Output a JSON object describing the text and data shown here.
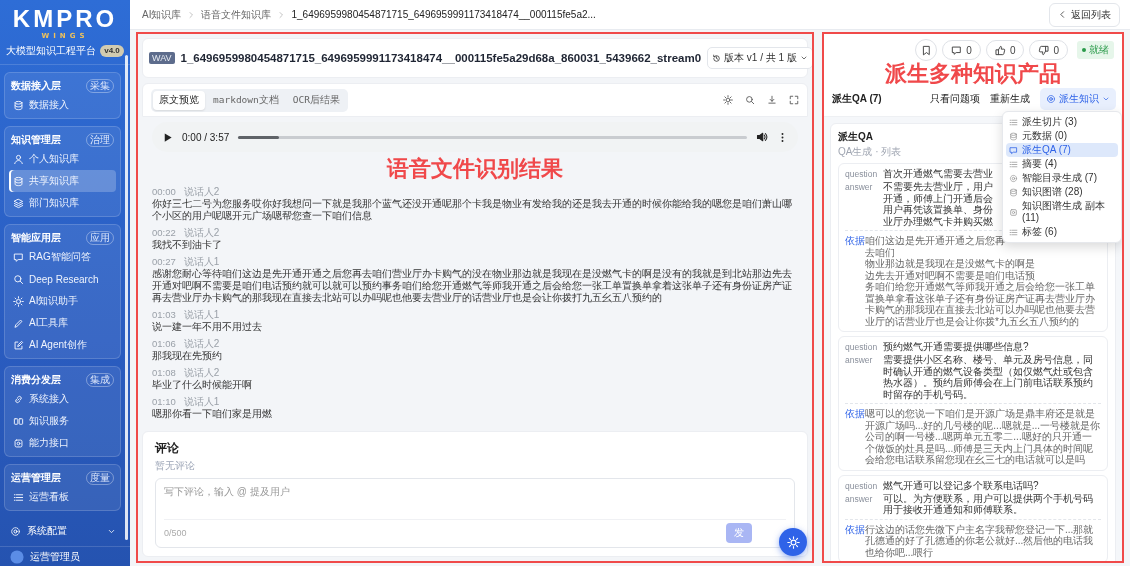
{
  "sidebar": {
    "logo": "KMPRO",
    "logo_subtitle": "WINGS",
    "platform": "大模型知识工程平台",
    "version": "v4.0",
    "groups": [
      {
        "title": "数据接入层",
        "badge": "采集",
        "items": [
          {
            "label": "数据接入",
            "selected": false
          }
        ]
      },
      {
        "title": "知识管理层",
        "badge": "治理",
        "items": [
          {
            "label": "个人知识库",
            "selected": false
          },
          {
            "label": "共享知识库",
            "selected": true
          },
          {
            "label": "部门知识库",
            "selected": false
          }
        ]
      },
      {
        "title": "智能应用层",
        "badge": "应用",
        "items": [
          {
            "label": "RAG智能问答",
            "selected": false
          },
          {
            "label": "Deep Research",
            "selected": false
          },
          {
            "label": "AI知识助手",
            "selected": false
          },
          {
            "label": "AI工具库",
            "selected": false
          },
          {
            "label": "AI Agent创作",
            "selected": false
          }
        ]
      },
      {
        "title": "消费分发层",
        "badge": "集成",
        "items": [
          {
            "label": "系统接入",
            "selected": false
          },
          {
            "label": "知识服务",
            "selected": false
          },
          {
            "label": "能力接口",
            "selected": false
          }
        ]
      },
      {
        "title": "运营管理层",
        "badge": "度量",
        "items": [
          {
            "label": "运营看板",
            "selected": false
          }
        ]
      }
    ],
    "settings": "系统配置",
    "user": "运营管理员"
  },
  "breadcrumb": [
    "AI知识库",
    "语音文件知识库",
    "1_6496959980454871715_6496959991173418474__000115fe5a2..."
  ],
  "back_button": "返回列表",
  "document": {
    "file_type": "WAV",
    "file_name": "1_6496959980454871715_6496959991173418474__000115fe5a29d68a_860031_5439662_stream0",
    "version": "版本 v1 / 共 1 版",
    "tabs": [
      {
        "label": "原文预览",
        "selected": true
      },
      {
        "label": "markdown文档",
        "selected": false
      },
      {
        "label": "OCR后结果",
        "selected": false
      }
    ],
    "player": {
      "time": "0:00 / 3:57",
      "level": 0.08
    },
    "annotation": "语音文件识别结果",
    "transcript": [
      {
        "time": "00:00",
        "speaker": "说话人2",
        "text": "你好三七二号为您服务哎你好我想问一下就是我那个蓝气还没开通呢那个卡我是物业有发给我的还是我去开通的时候你能给我的嗯您是咱们萧山哪个小区的用户呢嗯开元广场嗯帮您查一下咱们信息"
      },
      {
        "time": "00:22",
        "speaker": "说话人2",
        "text": "我找不到油卡了"
      },
      {
        "time": "00:27",
        "speaker": "说话人1",
        "text": "感谢您耐心等待咱们这边是先开通开通之后您再去咱们营业厅办卡购气的没在物业那边就是我现在是没燃气卡的啊是没有的我就是到北站那边先去开通对吧啊不需要是咱们电话预约就可以就可以预约事务咱们给您开通燃气等师我开通之后会给您一张工单置换单拿着这张单子还有身份证房产证再去营业厅办卡购气的那我现在直接去北站可以办吗呢也他要去营业厅的话营业厅也是会让你拨打九五幺五八预约的"
      },
      {
        "time": "01:03",
        "speaker": "说话人1",
        "text": "说一建一年不用不用过去"
      },
      {
        "time": "01:06",
        "speaker": "说话人2",
        "text": "那我现在先预约"
      },
      {
        "time": "01:08",
        "speaker": "说话人2",
        "text": "毕业了什么时候能开啊"
      },
      {
        "time": "01:10",
        "speaker": "说话人1",
        "text": "嗯那你看一下咱们家是用燃"
      }
    ],
    "comments": {
      "title": "评论",
      "empty": "暂无评论",
      "placeholder": "写下评论，输入 @ 提及用户",
      "count": "0/500",
      "submit": "发"
    }
  },
  "derived": {
    "actions": [
      {
        "kind": "bookmark"
      },
      {
        "kind": "comment",
        "count": "0"
      },
      {
        "kind": "like",
        "count": "0"
      },
      {
        "kind": "dislike",
        "count": "0"
      }
    ],
    "status": "就绪",
    "annotation": "派生多种知识产品",
    "title": "派生QA (7)",
    "filter": "只看问题项",
    "regenerate": "重新生成",
    "menu": {
      "label": "派生知识",
      "items": [
        {
          "label": "派生切片 (3)",
          "selected": false
        },
        {
          "label": "元数据 (0)",
          "selected": false
        },
        {
          "label": "派生QA (7)",
          "selected": true
        },
        {
          "label": "摘要 (4)",
          "selected": false
        },
        {
          "label": "智能目录生成 (7)",
          "selected": false
        },
        {
          "label": "知识图谱 (28)",
          "selected": false
        },
        {
          "label": "知识图谱生成 副本 (11)",
          "selected": false
        },
        {
          "label": "标签 (6)",
          "selected": false
        }
      ]
    },
    "section": {
      "title": "派生QA",
      "subtitle": "QA生成 · 列表"
    },
    "qa": [
      {
        "question_label": "question",
        "question": "首次开通燃气需要去营业",
        "answer_label": "answer",
        "answer_lines": [
          "不需要先去营业厅，用户",
          "开通，师傅上门开通后会",
          "用户再凭该置换单、身份",
          "业厅办理燃气卡并购买燃"
        ],
        "source_label": "依据",
        "source_lines": [
          "咱们这边是先开通开通之后您再去咱们",
          "物业那边就是我现在是没燃气卡的啊是",
          "边先去开通对吧啊不需要是咱们电话预",
          "务咱们给您开通燃气等师我开通之后会给您一张工单置换单拿看这张单子还有身份证房产证再去营业厅办卡购气的那我现在直接去北站可以办吗呢也他要去营业厅的话营业厅也是会让你拨*九五幺五八预约的"
        ]
      },
      {
        "question_label": "question",
        "question": "预约燃气开通需要提供哪些信息?",
        "answer_label": "answer",
        "answer": "需要提供小区名称、楼号、单元及房号信息，同时确认开通的燃气设备类型（如仅燃气灶或包含热水器）。预约后师傅会在上门前电话联系预约时留存的手机号码。",
        "source_label": "依据",
        "source": "嗯可以的您说一下咱们是开源广场是鼎丰府还是就是开源广场吗...好的几号楼的呢...嗯就是...一号楼就是你公司的啊一号楼...嗯两单元五零二...嗯好的只开通一个做饭的灶具是吗...师傅是三天内上门具体的时间呢会给您电话联系留您现在幺三七的电话就可以是吗"
      },
      {
        "question_label": "question",
        "question": "燃气开通可以登记多个联系电话吗?",
        "answer_label": "answer",
        "answer": "可以。为方便联系，用户可以提供两个手机号码用于接收开通通知和师傅联系。",
        "source_label": "依据",
        "source": "行这边的话您先微下户主名字我帮您登记一下...那就孔德通的好了孔德通的你老公就好...然后他的电话我也给你吧...喂行"
      }
    ]
  }
}
